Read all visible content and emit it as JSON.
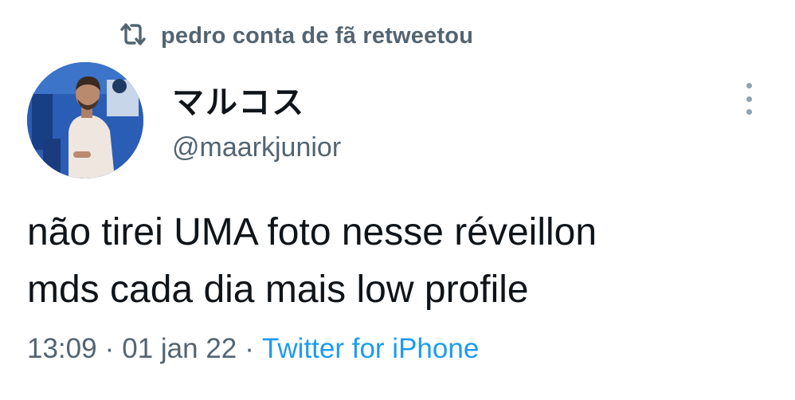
{
  "retweet": {
    "icon": "retweet-icon",
    "text": "pedro conta de fã retweetou"
  },
  "author": {
    "display_name": "マルコス",
    "handle": "@maarkjunior",
    "avatar_icon": "user-avatar"
  },
  "tweet": {
    "line1": "não tirei UMA foto nesse réveillon",
    "line2": "mds cada dia mais low profile"
  },
  "meta": {
    "time": "13:09",
    "separator": "·",
    "date": "01 jan 22",
    "source": "Twitter for iPhone"
  },
  "colors": {
    "text": "#0f1419",
    "secondary": "#536471",
    "link": "#1d9bf0"
  }
}
